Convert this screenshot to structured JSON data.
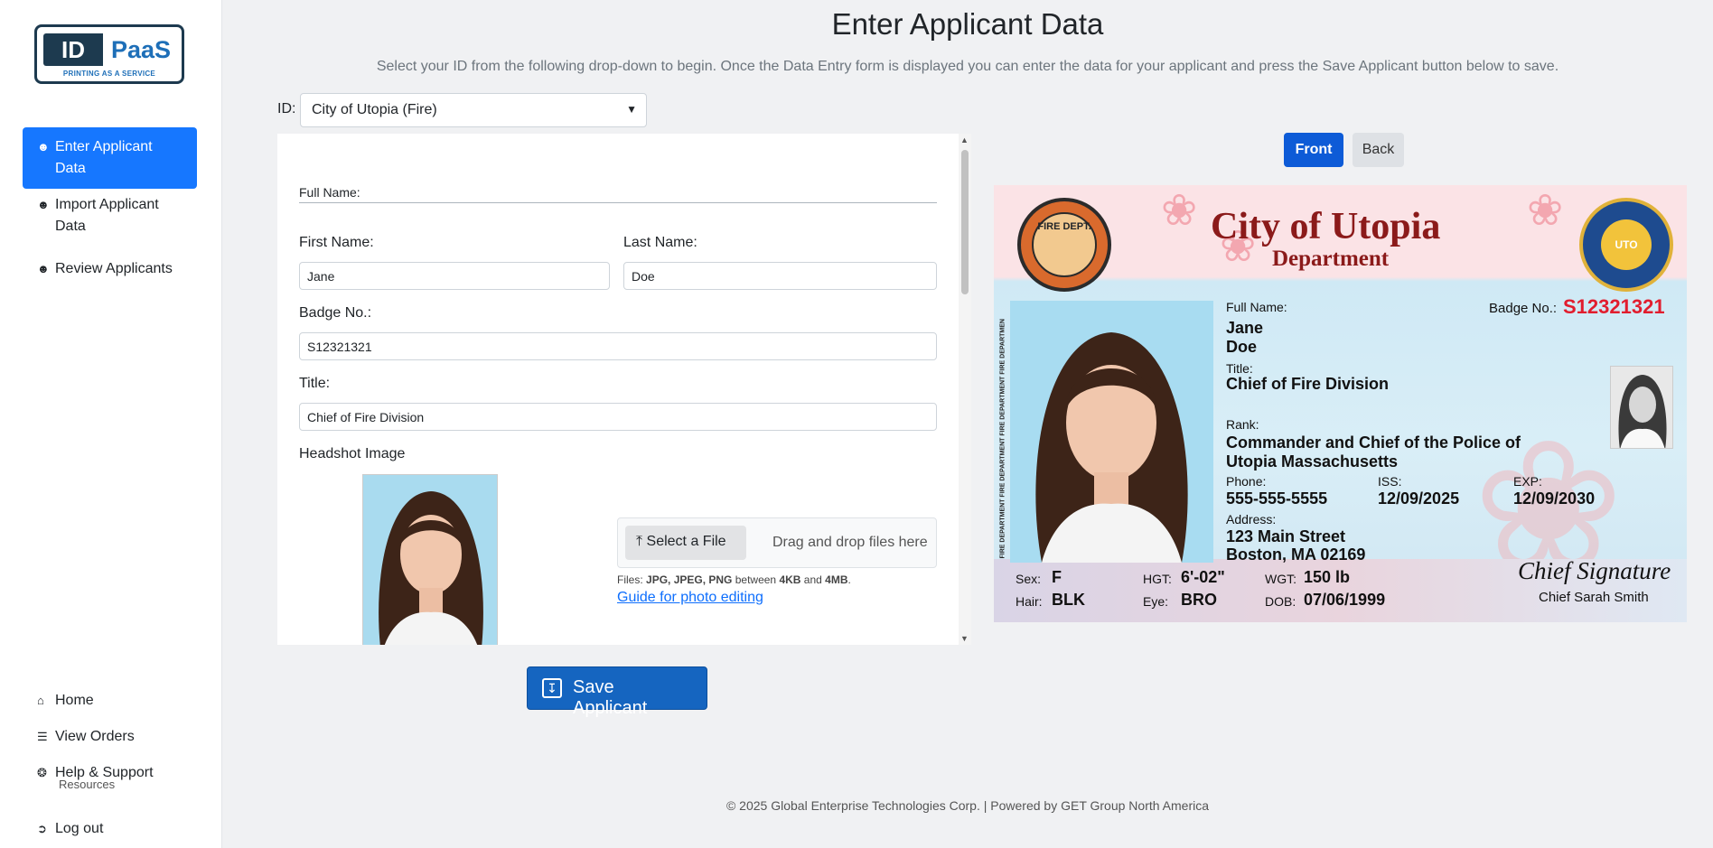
{
  "sidebar": {
    "logo": {
      "id": "ID",
      "paas": "PaaS",
      "tagline": "PRINTING AS A SERVICE"
    },
    "nav": [
      {
        "label": "Enter Applicant Data",
        "icon": "user-list-icon",
        "active": true
      },
      {
        "label": "Import Applicant Data",
        "icon": "user-list-icon",
        "active": false
      },
      {
        "label": "Review Applicants",
        "icon": "user-list-icon",
        "active": false
      }
    ],
    "bottom": [
      {
        "label": "Home",
        "icon": "home-icon"
      },
      {
        "label": "View Orders",
        "icon": "list-icon"
      },
      {
        "label": "Help & Support",
        "icon": "lifebuoy-icon",
        "sub": "Resources"
      },
      {
        "label": "Log out",
        "icon": "logout-icon"
      }
    ]
  },
  "page": {
    "title": "Enter Applicant Data",
    "subtitle": "Select your ID from the following drop-down to begin. Once the Data Entry form is displayed you can enter the data for your applicant and press the Save Applicant button below to save."
  },
  "id_select": {
    "label": "ID:",
    "value": "City of Utopia (Fire)"
  },
  "form": {
    "full_name_label": "Full Name:",
    "first_name_label": "First Name:",
    "first_name_value": "Jane",
    "last_name_label": "Last Name:",
    "last_name_value": "Doe",
    "badge_label": "Badge No.:",
    "badge_value": "S12321321",
    "title_label": "Title:",
    "title_value": "Chief of Fire Division",
    "headshot_label": "Headshot Image",
    "upload_button": "Select a File",
    "drag_text": "Drag and drop files here",
    "files_note_prefix": "Files: ",
    "files_types": "JPG, JPEG, PNG",
    "files_between": " between ",
    "files_min": "4KB",
    "files_and": " and ",
    "files_max": "4MB",
    "files_end": ".",
    "guide_link": "Guide for photo editing"
  },
  "save_button": "Save Applicant",
  "preview": {
    "front_label": "Front",
    "back_label": "Back",
    "card": {
      "fire_badge_text": "FIRE DEPT.",
      "seal_text": "UTO",
      "city": "City of Utopia",
      "department": "Department",
      "vertical_text": "FIRE DEPARTMENT FIRE DEPARTMENT FIRE DEPARTMENT FIRE DEPARTMEN",
      "full_name_label": "Full Name:",
      "first_name": "Jane",
      "last_name": "Doe",
      "badge_label": "Badge No.:",
      "badge_value": "S12321321",
      "title_label": "Title:",
      "title_value": "Chief of Fire Division",
      "rank_label": "Rank:",
      "rank_line1": "Commander and Chief of the Police of",
      "rank_line2": "Utopia Massachusetts",
      "phone_label": "Phone:",
      "phone_value": "555-555-5555",
      "iss_label": "ISS:",
      "iss_value": "12/09/2025",
      "exp_label": "EXP:",
      "exp_value": "12/09/2030",
      "address_label": "Address:",
      "address_line1": "123 Main Street",
      "address_line2": "Boston, MA 02169",
      "sex_label": "Sex:",
      "sex_value": "F",
      "hgt_label": "HGT:",
      "hgt_value": "6'-02\"",
      "wgt_label": "WGT:",
      "wgt_value": "150 lb",
      "hair_label": "Hair:",
      "hair_value": "BLK",
      "eye_label": "Eye:",
      "eye_value": "BRO",
      "dob_label": "DOB:",
      "dob_value": "07/06/1999",
      "signature": "Chief Signature",
      "signer": "Chief Sarah Smith"
    }
  },
  "footer": "© 2025 Global Enterprise Technologies Corp. | Powered by GET Group North America",
  "colors": {
    "primary": "#1677ff",
    "save": "#1565c0",
    "card_red": "#8b1a1a",
    "badge_red": "#e11d2e"
  }
}
